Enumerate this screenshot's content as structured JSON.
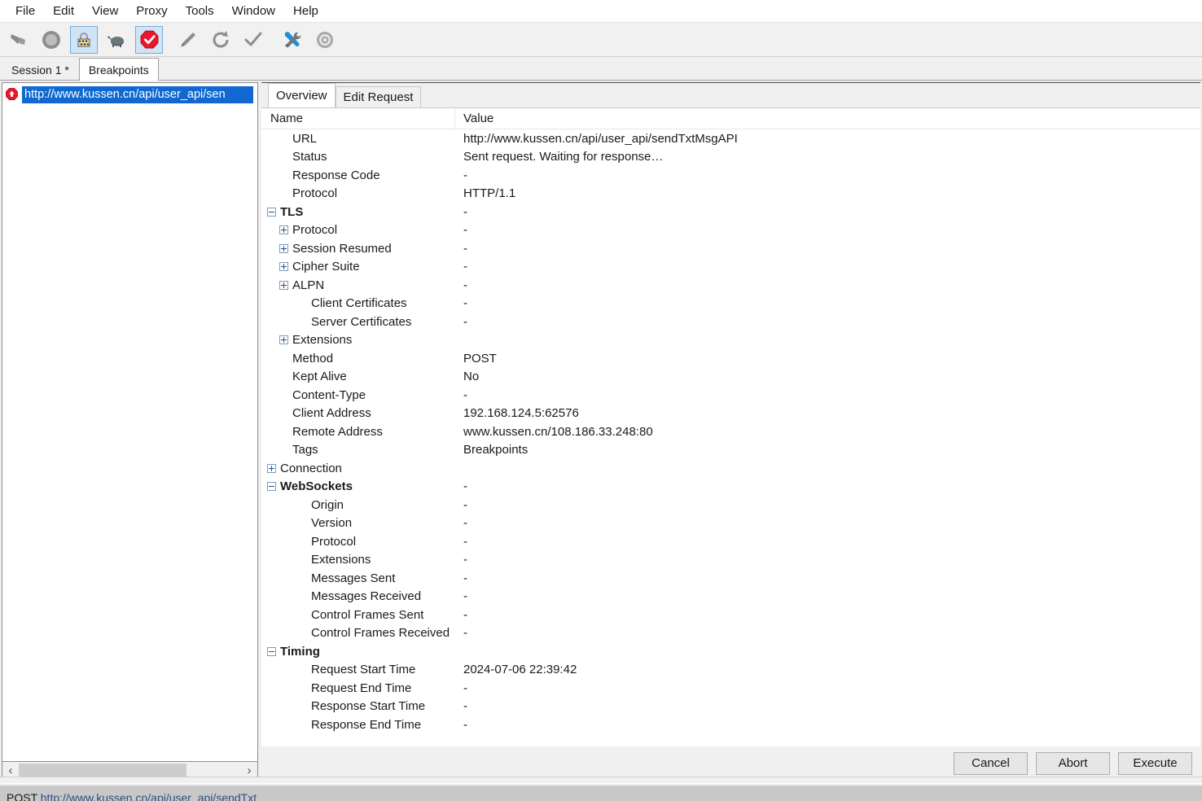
{
  "menu": {
    "items": [
      {
        "label": "File"
      },
      {
        "label": "Edit"
      },
      {
        "label": "View"
      },
      {
        "label": "Proxy"
      },
      {
        "label": "Tools"
      },
      {
        "label": "Window"
      },
      {
        "label": "Help"
      }
    ]
  },
  "toolbar": {
    "buttons": [
      {
        "name": "clear-icon",
        "tooltip": "Clear Session",
        "active": false
      },
      {
        "name": "record-icon",
        "tooltip": "Start/Stop Recording",
        "active": false
      },
      {
        "name": "ssl-proxying-icon",
        "tooltip": "Enable SSL Proxying",
        "active": true
      },
      {
        "name": "throttle-turtle-icon",
        "tooltip": "Start/Stop Throttling",
        "active": false
      },
      {
        "name": "breakpoints-stop-icon",
        "tooltip": "Enable Breakpoints",
        "active": true
      },
      {
        "name": "compose-pen-icon",
        "tooltip": "Compose",
        "active": false
      },
      {
        "name": "repeat-refresh-icon",
        "tooltip": "Repeat",
        "active": false
      },
      {
        "name": "validate-check-icon",
        "tooltip": "Validate",
        "active": false
      },
      {
        "name": "tools-wrench-icon",
        "tooltip": "Tools",
        "active": false
      },
      {
        "name": "settings-gear-icon",
        "tooltip": "Settings",
        "active": false
      }
    ]
  },
  "session_tabs": [
    {
      "label": "Session 1 *",
      "selected": false
    },
    {
      "label": "Breakpoints",
      "selected": true
    }
  ],
  "left_panel": {
    "breakpoint_item": {
      "icon": "breakpoint-stop-icon",
      "label": "http://www.kussen.cn/api/user_api/sen",
      "selected": true
    },
    "scroll": {
      "left_arrow": "‹",
      "right_arrow": "›"
    }
  },
  "detail_tabs": [
    {
      "label": "Overview",
      "selected": true
    },
    {
      "label": "Edit Request",
      "selected": false
    }
  ],
  "table": {
    "columns": [
      "Name",
      "Value"
    ],
    "rows": [
      {
        "name": "URL",
        "value": "http://www.kussen.cn/api/user_api/sendTxtMsgAPI",
        "indent": 1,
        "toggle": "none",
        "bold": false
      },
      {
        "name": "Status",
        "value": "Sent request. Waiting for response…",
        "indent": 1,
        "toggle": "none",
        "bold": false
      },
      {
        "name": "Response Code",
        "value": "-",
        "indent": 1,
        "toggle": "none",
        "bold": false
      },
      {
        "name": "Protocol",
        "value": "HTTP/1.1",
        "indent": 1,
        "toggle": "none",
        "bold": false
      },
      {
        "name": "TLS",
        "value": "-",
        "indent": 0,
        "toggle": "minus",
        "bold": true
      },
      {
        "name": "Protocol",
        "value": "-",
        "indent": 1,
        "toggle": "plus",
        "bold": false
      },
      {
        "name": "Session Resumed",
        "value": "-",
        "indent": 1,
        "toggle": "plus",
        "bold": false
      },
      {
        "name": "Cipher Suite",
        "value": "-",
        "indent": 1,
        "toggle": "plus",
        "bold": false
      },
      {
        "name": "ALPN",
        "value": "-",
        "indent": 1,
        "toggle": "plus",
        "bold": false
      },
      {
        "name": "Client Certificates",
        "value": "-",
        "indent": 2,
        "toggle": "none",
        "bold": false
      },
      {
        "name": "Server Certificates",
        "value": "-",
        "indent": 2,
        "toggle": "none",
        "bold": false
      },
      {
        "name": "Extensions",
        "value": "",
        "indent": 1,
        "toggle": "plus",
        "bold": false
      },
      {
        "name": "Method",
        "value": "POST",
        "indent": 1,
        "toggle": "none",
        "bold": false
      },
      {
        "name": "Kept Alive",
        "value": "No",
        "indent": 1,
        "toggle": "none",
        "bold": false
      },
      {
        "name": "Content-Type",
        "value": "-",
        "indent": 1,
        "toggle": "none",
        "bold": false
      },
      {
        "name": "Client Address",
        "value": "192.168.124.5:62576",
        "indent": 1,
        "toggle": "none",
        "bold": false
      },
      {
        "name": "Remote Address",
        "value": "www.kussen.cn/108.186.33.248:80",
        "indent": 1,
        "toggle": "none",
        "bold": false
      },
      {
        "name": "Tags",
        "value": "Breakpoints",
        "indent": 1,
        "toggle": "none",
        "bold": false
      },
      {
        "name": "Connection",
        "value": "",
        "indent": 0,
        "toggle": "plus",
        "bold": false
      },
      {
        "name": "WebSockets",
        "value": "-",
        "indent": 0,
        "toggle": "minus",
        "bold": true
      },
      {
        "name": "Origin",
        "value": "-",
        "indent": 2,
        "toggle": "none",
        "bold": false
      },
      {
        "name": "Version",
        "value": "-",
        "indent": 2,
        "toggle": "none",
        "bold": false
      },
      {
        "name": "Protocol",
        "value": "-",
        "indent": 2,
        "toggle": "none",
        "bold": false
      },
      {
        "name": "Extensions",
        "value": "-",
        "indent": 2,
        "toggle": "none",
        "bold": false
      },
      {
        "name": "Messages Sent",
        "value": "-",
        "indent": 2,
        "toggle": "none",
        "bold": false
      },
      {
        "name": "Messages Received",
        "value": "-",
        "indent": 2,
        "toggle": "none",
        "bold": false
      },
      {
        "name": "Control Frames Sent",
        "value": "-",
        "indent": 2,
        "toggle": "none",
        "bold": false
      },
      {
        "name": "Control Frames Received",
        "value": "-",
        "indent": 2,
        "toggle": "none",
        "bold": false
      },
      {
        "name": "Timing",
        "value": "",
        "indent": 0,
        "toggle": "minus",
        "bold": true
      },
      {
        "name": "Request Start Time",
        "value": "2024-07-06 22:39:42",
        "indent": 2,
        "toggle": "none",
        "bold": false
      },
      {
        "name": "Request End Time",
        "value": "-",
        "indent": 2,
        "toggle": "none",
        "bold": false
      },
      {
        "name": "Response Start Time",
        "value": "-",
        "indent": 2,
        "toggle": "none",
        "bold": false
      },
      {
        "name": "Response End Time",
        "value": "-",
        "indent": 2,
        "toggle": "none",
        "bold": false
      }
    ]
  },
  "actions": {
    "cancel": "Cancel",
    "abort": "Abort",
    "execute": "Execute"
  },
  "statusbar": {
    "method": "POST",
    "url": "http://www.kussen.cn/api/user_api/sendTxt"
  },
  "colors": {
    "selection_blue": "#1068d0",
    "breakpoint_red": "#e8172b",
    "toolbar_active": "#cfe4f7",
    "accent_blue": "#2b4f7d"
  }
}
